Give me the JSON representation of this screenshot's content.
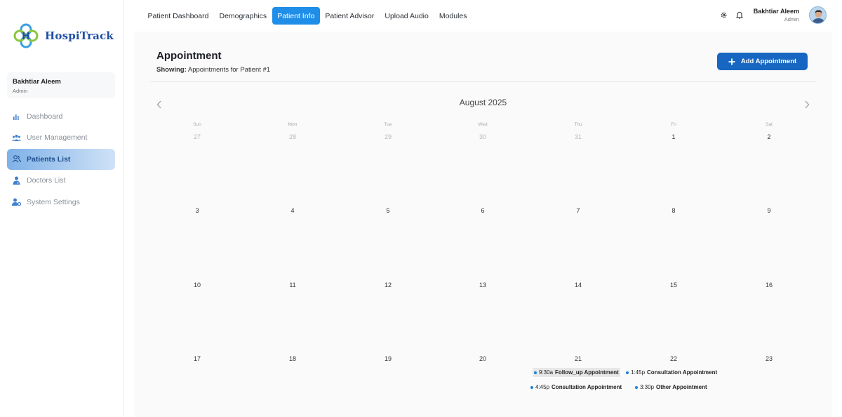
{
  "app": {
    "name": "HospiTrack"
  },
  "sidebar": {
    "user": {
      "name": "Bakhtiar Aleem",
      "role": "Admin"
    },
    "items": [
      {
        "label": "Dashboard",
        "icon": "bar-chart-icon",
        "active": false
      },
      {
        "label": "User Management",
        "icon": "users-icon",
        "active": false
      },
      {
        "label": "Patients List",
        "icon": "patients-icon",
        "active": true
      },
      {
        "label": "Doctors List",
        "icon": "doctor-icon",
        "active": false
      },
      {
        "label": "System Settings",
        "icon": "user-settings-icon",
        "active": false
      }
    ]
  },
  "topbar": {
    "tabs": [
      {
        "label": "Patient Dashboard",
        "active": false
      },
      {
        "label": "Demographics",
        "active": false
      },
      {
        "label": "Patient Info",
        "active": true
      },
      {
        "label": "Patient Advisor",
        "active": false
      },
      {
        "label": "Upload Audio",
        "active": false
      },
      {
        "label": "Modules",
        "active": false
      }
    ],
    "user": {
      "name": "Bakhtiar Aleem",
      "role": "Admin"
    }
  },
  "page": {
    "title": "Appointment",
    "showing_label": "Showing:",
    "showing_value": "Appointments for Patient #1",
    "add_button": "Add Appointment"
  },
  "calendar": {
    "month": "August 2025",
    "weekdays": [
      "Sun",
      "Mon",
      "Tue",
      "Wed",
      "Thu",
      "Fri",
      "Sat"
    ],
    "weeks": [
      [
        "27",
        "28",
        "29",
        "30",
        "31",
        "1",
        "2"
      ],
      [
        "3",
        "4",
        "5",
        "6",
        "7",
        "8",
        "9"
      ],
      [
        "10",
        "11",
        "12",
        "13",
        "14",
        "15",
        "16"
      ],
      [
        "17",
        "18",
        "19",
        "20",
        "21",
        "22",
        "23"
      ]
    ],
    "events": [
      {
        "time": "9:30a",
        "title": "Follow_up Appointment"
      },
      {
        "time": "1:45p",
        "title": "Consultation Appointment"
      },
      {
        "time": "4:45p",
        "title": "Consultation Appointment"
      },
      {
        "time": "3:30p",
        "title": "Other Appointment"
      }
    ]
  },
  "colors": {
    "accent": "#1f8ee8",
    "button": "#1766c1",
    "event_dot": "#1f7fd6"
  }
}
